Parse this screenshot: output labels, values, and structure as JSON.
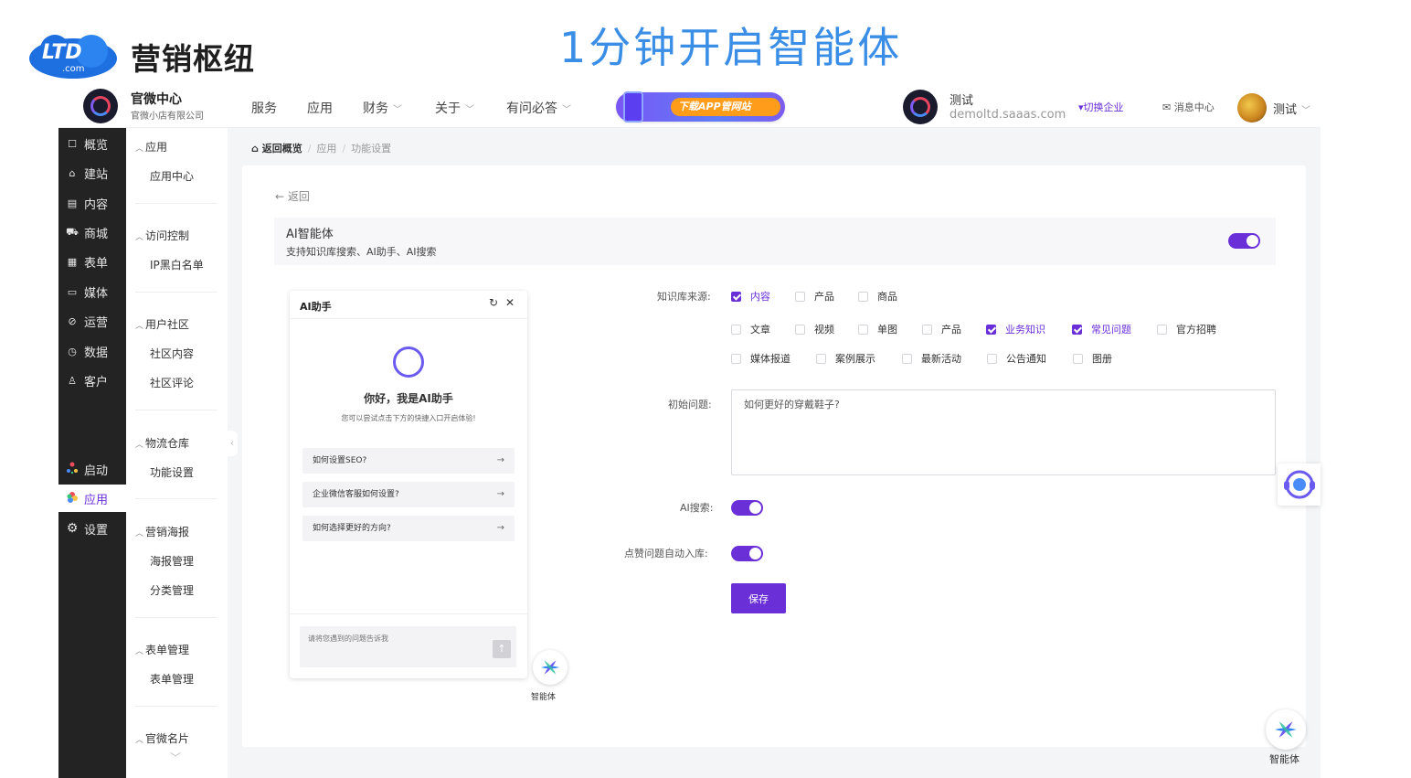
{
  "brand": {
    "logo_text": "LTD",
    "logo_sub": ".com",
    "name": "营销枢纽"
  },
  "slide_title": "1分钟开启智能体",
  "topbar": {
    "org_name": "官微中心",
    "org_sub": "官微小店有限公司",
    "nav": [
      "服务",
      "应用",
      "财务",
      "关于",
      "有问必答"
    ],
    "banner_text": "下载APP管网站",
    "store_name": "测试",
    "store_domain": "demoltd.saaas.com",
    "switch_label": "▾切换企业",
    "msg_label": "✉ 消息中心",
    "user_name": "测试"
  },
  "side_dark": {
    "items": [
      {
        "icon": "☐",
        "label": "概览"
      },
      {
        "icon": "⌂",
        "label": "建站"
      },
      {
        "icon": "▤",
        "label": "内容"
      },
      {
        "icon": "⛟",
        "label": "商城"
      },
      {
        "icon": "▦",
        "label": "表单"
      },
      {
        "icon": "▭",
        "label": "媒体"
      },
      {
        "icon": "⊘",
        "label": "运营"
      },
      {
        "icon": "◷",
        "label": "数据"
      },
      {
        "icon": "♙",
        "label": "客户"
      }
    ],
    "launch": "启动",
    "app": "应用",
    "settings": "设置"
  },
  "side_sub": {
    "groups": [
      {
        "title": "应用",
        "items": [
          "应用中心"
        ]
      },
      {
        "title": "访问控制",
        "items": [
          "IP黑白名单"
        ]
      },
      {
        "title": "用户社区",
        "items": [
          "社区内容",
          "社区评论"
        ]
      },
      {
        "title": "物流仓库",
        "items": [
          "功能设置"
        ]
      },
      {
        "title": "营销海报",
        "items": [
          "海报管理",
          "分类管理"
        ]
      },
      {
        "title": "表单管理",
        "items": [
          "表单管理"
        ]
      },
      {
        "title": "官微名片",
        "items": []
      }
    ]
  },
  "breadcrumb": {
    "home": "返回概览",
    "level1": "应用",
    "level2": "功能设置"
  },
  "content": {
    "back": "← 返回",
    "feature_title": "AI智能体",
    "feature_desc": "支持知识库搜索、AI助手、AI搜索",
    "feature_enabled": true
  },
  "chat": {
    "title": "AI助手",
    "greeting": "你好，我是AI助手",
    "hint": "您可以尝试点击下方的快捷入口开启体验!",
    "questions": [
      "如何设置SEO?",
      "企业微信客服如何设置?",
      "如何选择更好的方向?"
    ],
    "input_placeholder": "请将您遇到的问题告诉我",
    "agent_label": "智能体"
  },
  "form": {
    "kb_label": "知识库来源:",
    "kb_row1": [
      {
        "label": "内容",
        "checked": true
      },
      {
        "label": "产品",
        "checked": false
      },
      {
        "label": "商品",
        "checked": false
      }
    ],
    "kb_row2": [
      {
        "label": "文章",
        "checked": false
      },
      {
        "label": "视频",
        "checked": false
      },
      {
        "label": "单图",
        "checked": false
      },
      {
        "label": "产品",
        "checked": false
      },
      {
        "label": "业务知识",
        "checked": true
      },
      {
        "label": "常见问题",
        "checked": true
      },
      {
        "label": "官方招聘",
        "checked": false
      }
    ],
    "kb_row3": [
      {
        "label": "媒体报道",
        "checked": false
      },
      {
        "label": "案例展示",
        "checked": false
      },
      {
        "label": "最新活动",
        "checked": false
      },
      {
        "label": "公告通知",
        "checked": false
      },
      {
        "label": "图册",
        "checked": false
      }
    ],
    "init_label": "初始问题:",
    "init_value": "如何更好的穿戴鞋子?",
    "ai_search_label": "AI搜索:",
    "ai_search_on": true,
    "auto_add_label": "点赞问题自动入库:",
    "auto_add_on": true,
    "save": "保存"
  },
  "float": {
    "agent_label": "智能体"
  },
  "colors": {
    "accent": "#6b2fd8",
    "title_blue": "#3a8ee6",
    "sidebar_dark": "#232323"
  }
}
